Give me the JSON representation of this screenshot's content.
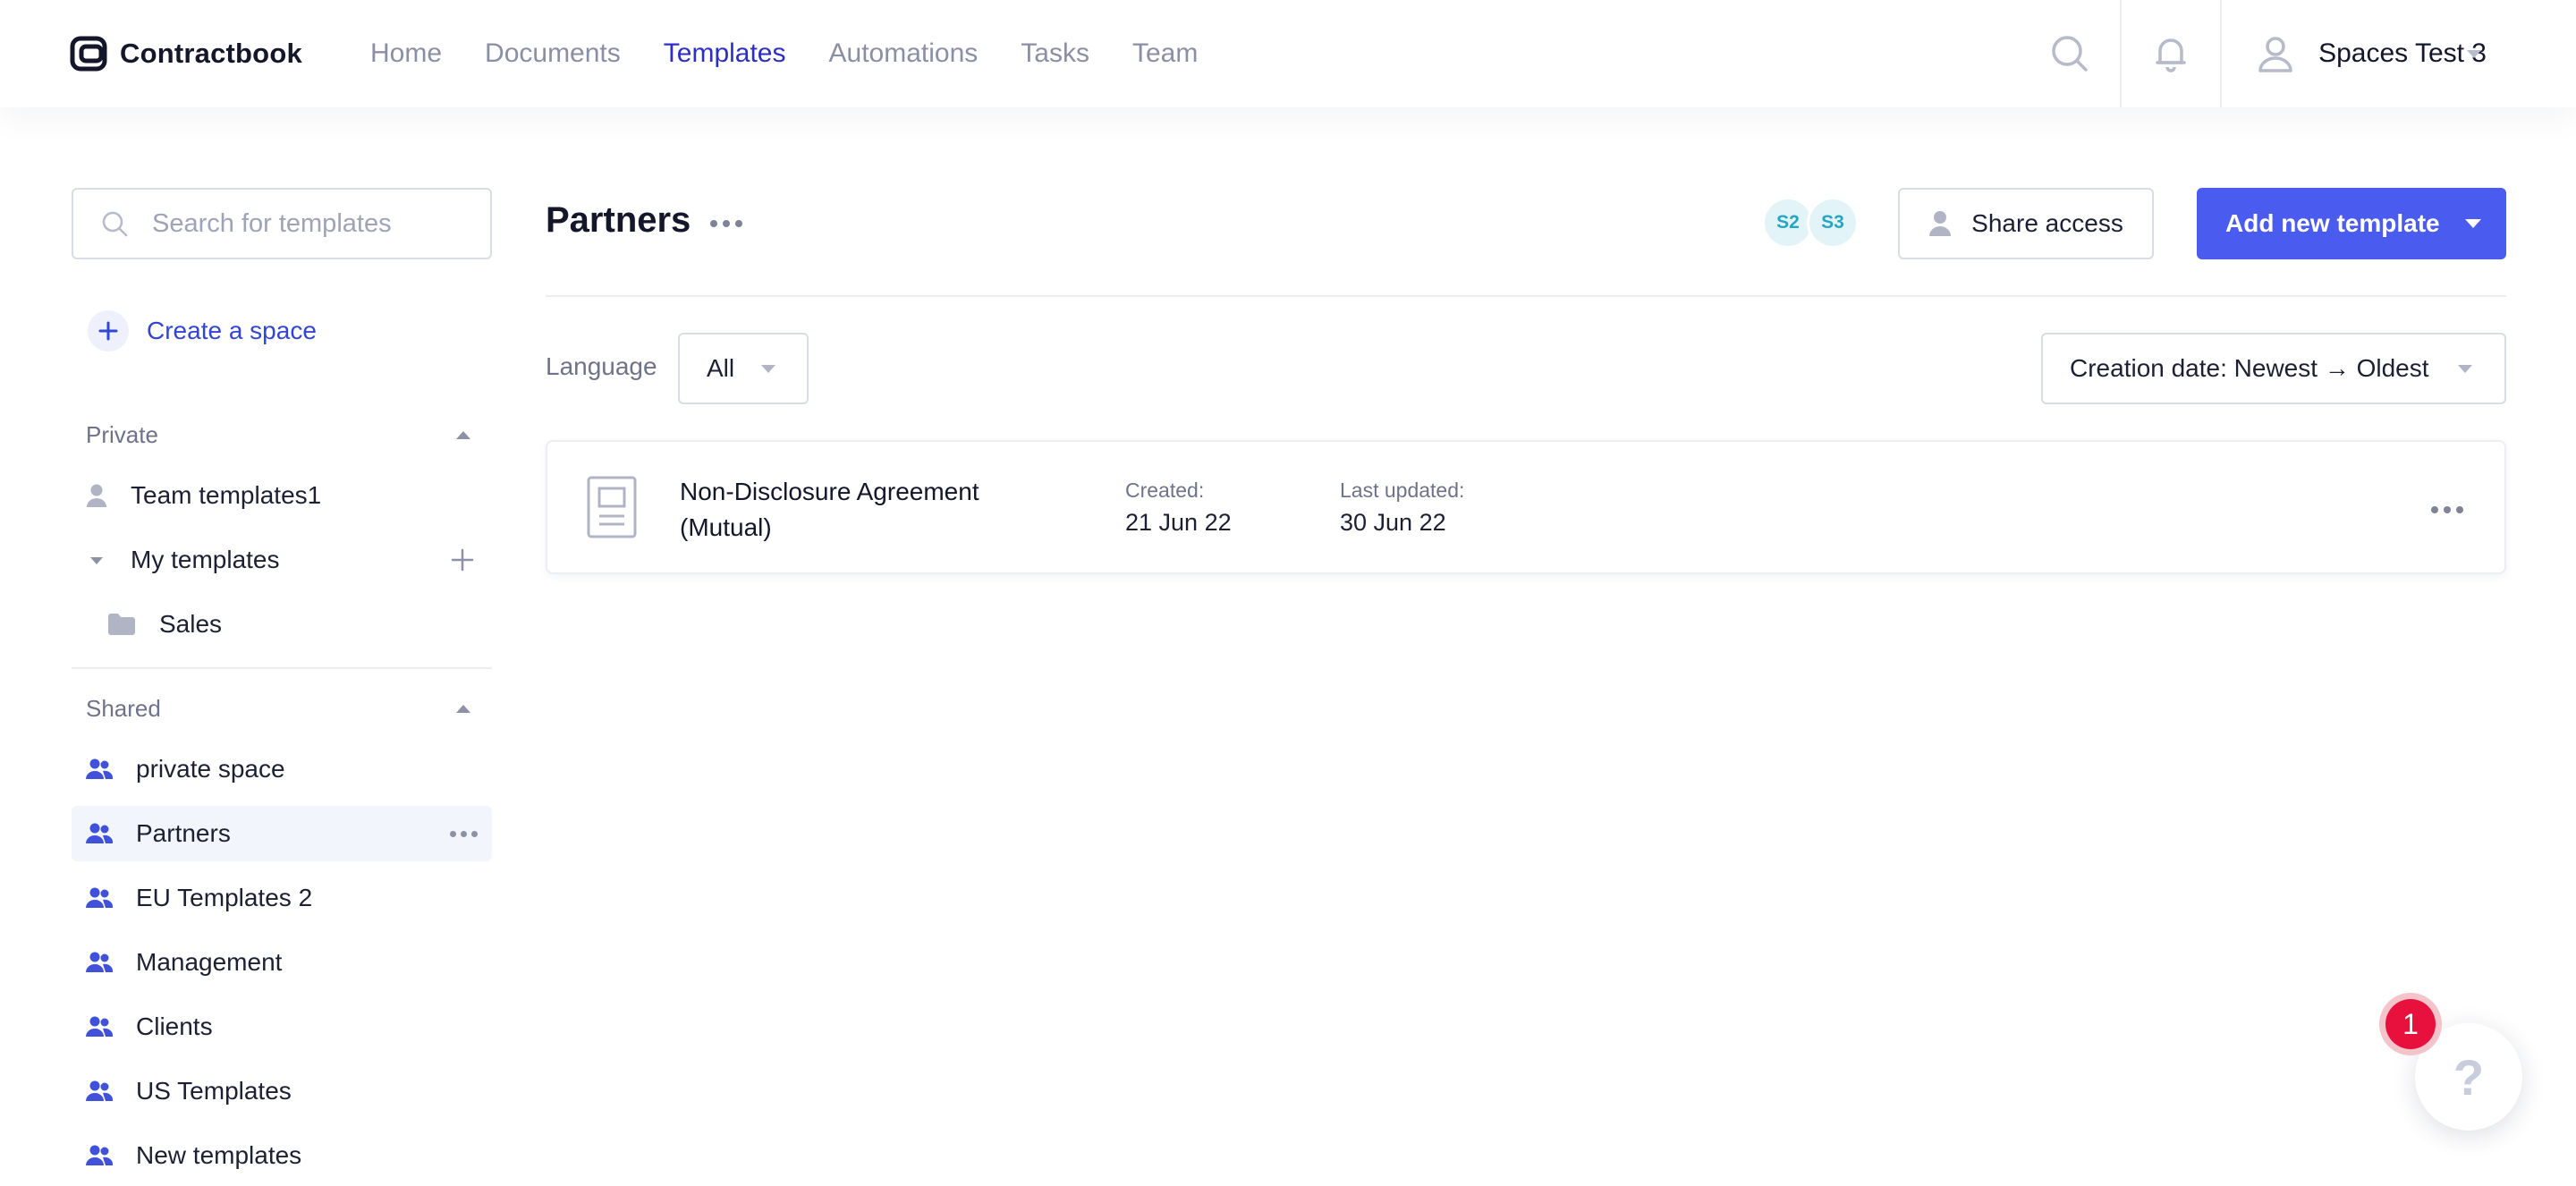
{
  "app": {
    "name": "Contractbook"
  },
  "nav": {
    "items": [
      {
        "label": "Home",
        "active": false
      },
      {
        "label": "Documents",
        "active": false
      },
      {
        "label": "Templates",
        "active": true
      },
      {
        "label": "Automations",
        "active": false
      },
      {
        "label": "Tasks",
        "active": false
      },
      {
        "label": "Team",
        "active": false
      }
    ],
    "user_name": "Spaces Test 3"
  },
  "sidebar": {
    "search_placeholder": "Search for templates",
    "create_space_label": "Create a space",
    "private": {
      "title": "Private",
      "items": [
        {
          "label": "Team templates1",
          "icon": "user-icon"
        },
        {
          "label": "My templates",
          "icon": "chevron-down-icon"
        },
        {
          "label": "Sales",
          "icon": "folder-icon"
        }
      ]
    },
    "shared": {
      "title": "Shared",
      "items": [
        {
          "label": "private space",
          "icon": "users-icon"
        },
        {
          "label": "Partners",
          "icon": "users-icon",
          "selected": true
        },
        {
          "label": "EU Templates 2",
          "icon": "users-icon"
        },
        {
          "label": "Management",
          "icon": "users-icon"
        },
        {
          "label": "Clients",
          "icon": "users-icon"
        },
        {
          "label": "US Templates",
          "icon": "users-icon"
        },
        {
          "label": "New templates",
          "icon": "users-icon"
        }
      ]
    }
  },
  "main": {
    "title": "Partners",
    "avatars": [
      "S2",
      "S3"
    ],
    "share_label": "Share access",
    "add_label": "Add new template",
    "language_label": "Language",
    "language_value": "All",
    "sort_value": "Creation date: Newest → Oldest",
    "templates": [
      {
        "name": "Non-Disclosure Agreement (Mutual)",
        "created_label": "Created:",
        "created": "21 Jun 22",
        "updated_label": "Last updated:",
        "updated": "30 Jun 22"
      }
    ]
  },
  "help": {
    "badge_count": "1",
    "label": "?"
  },
  "colors": {
    "accent": "#4a5cf0",
    "nav_active": "#2d2fc4",
    "link": "#3246d3",
    "badge": "#e8113d",
    "avatar_text": "#26a6c2"
  }
}
